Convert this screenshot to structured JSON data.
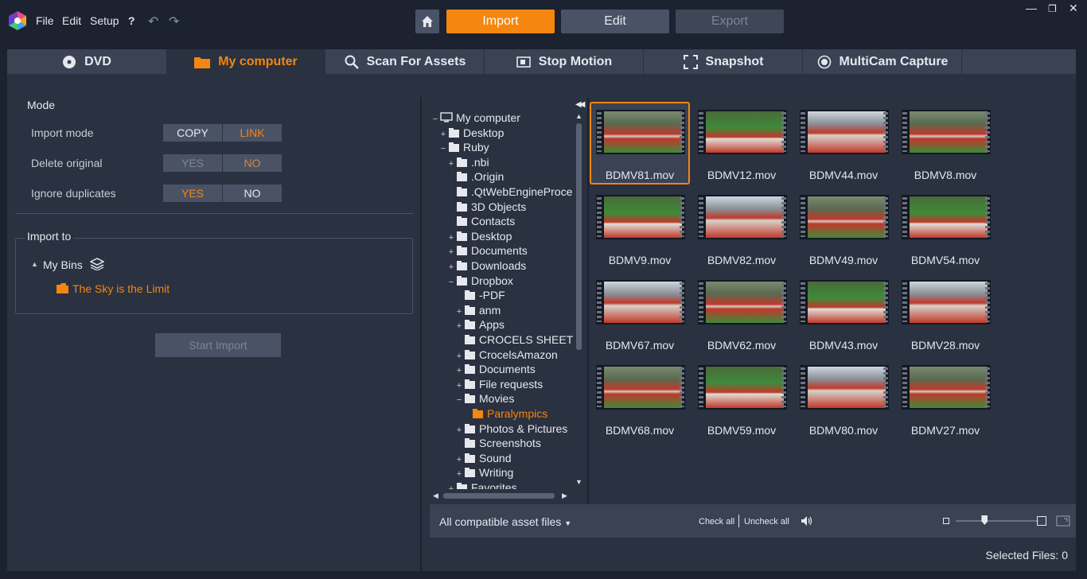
{
  "menu": {
    "file": "File",
    "edit": "Edit",
    "setup": "Setup",
    "help": "?"
  },
  "nav": {
    "import": "Import",
    "edit": "Edit",
    "export": "Export"
  },
  "tabs": [
    "DVD",
    "My computer",
    "Scan For Assets",
    "Stop Motion",
    "Snapshot",
    "MultiCam Capture"
  ],
  "mode": {
    "heading": "Mode",
    "rows": [
      {
        "label": "Import mode",
        "opt1": "COPY",
        "opt2": "LINK",
        "selected": "LINK"
      },
      {
        "label": "Delete original",
        "opt1": "YES",
        "opt2": "NO",
        "selected": "NO"
      },
      {
        "label": "Ignore duplicates",
        "opt1": "YES",
        "opt2": "NO",
        "selected": "YES"
      }
    ]
  },
  "import_to": {
    "heading": "Import to",
    "root": "My Bins",
    "bin": "The Sky is the Limit"
  },
  "start_import": "Start Import",
  "tree": [
    {
      "label": "My computer",
      "toggle": "−",
      "depth": 0
    },
    {
      "label": "Desktop",
      "toggle": "+",
      "depth": 1
    },
    {
      "label": "Ruby",
      "toggle": "−",
      "depth": 1
    },
    {
      "label": ".nbi",
      "toggle": "+",
      "depth": 2
    },
    {
      "label": ".Origin",
      "toggle": "",
      "depth": 2
    },
    {
      "label": ".QtWebEngineProces",
      "toggle": "",
      "depth": 2
    },
    {
      "label": "3D Objects",
      "toggle": "",
      "depth": 2
    },
    {
      "label": "Contacts",
      "toggle": "",
      "depth": 2
    },
    {
      "label": "Desktop",
      "toggle": "+",
      "depth": 2
    },
    {
      "label": "Documents",
      "toggle": "+",
      "depth": 2
    },
    {
      "label": "Downloads",
      "toggle": "+",
      "depth": 2
    },
    {
      "label": "Dropbox",
      "toggle": "−",
      "depth": 2
    },
    {
      "label": "-PDF",
      "toggle": "",
      "depth": 3
    },
    {
      "label": "anm",
      "toggle": "+",
      "depth": 3
    },
    {
      "label": "Apps",
      "toggle": "+",
      "depth": 3
    },
    {
      "label": "CROCELS SHEETS",
      "toggle": "",
      "depth": 3
    },
    {
      "label": "CrocelsAmazon",
      "toggle": "+",
      "depth": 3
    },
    {
      "label": "Documents",
      "toggle": "+",
      "depth": 3
    },
    {
      "label": "File requests",
      "toggle": "+",
      "depth": 3
    },
    {
      "label": "Movies",
      "toggle": "−",
      "depth": 3
    },
    {
      "label": "Paralympics",
      "toggle": "",
      "depth": 4,
      "selected": true
    },
    {
      "label": "Photos & Pictures",
      "toggle": "+",
      "depth": 3
    },
    {
      "label": "Screenshots",
      "toggle": "",
      "depth": 3
    },
    {
      "label": "Sound",
      "toggle": "+",
      "depth": 3
    },
    {
      "label": "Writing",
      "toggle": "+",
      "depth": 3
    },
    {
      "label": "Favorites",
      "toggle": "+",
      "depth": 2
    }
  ],
  "files": [
    "BDMV81.mov",
    "BDMV12.mov",
    "BDMV44.mov",
    "BDMV8.mov",
    "BDMV9.mov",
    "BDMV82.mov",
    "BDMV49.mov",
    "BDMV54.mov",
    "BDMV67.mov",
    "BDMV62.mov",
    "BDMV43.mov",
    "BDMV28.mov",
    "BDMV68.mov",
    "BDMV59.mov",
    "BDMV80.mov",
    "BDMV27.mov"
  ],
  "selected_file": "BDMV81.mov",
  "bottom": {
    "filter": "All compatible asset files",
    "check_all": "Check all",
    "uncheck_all": "Uncheck all",
    "zoom": 0.35
  },
  "status": {
    "selected_files": "Selected Files: 0"
  },
  "colors": {
    "accent": "#f5860f",
    "bg": "#2a3140",
    "track": "#c0392b",
    "grass": "#3e8a3a"
  }
}
